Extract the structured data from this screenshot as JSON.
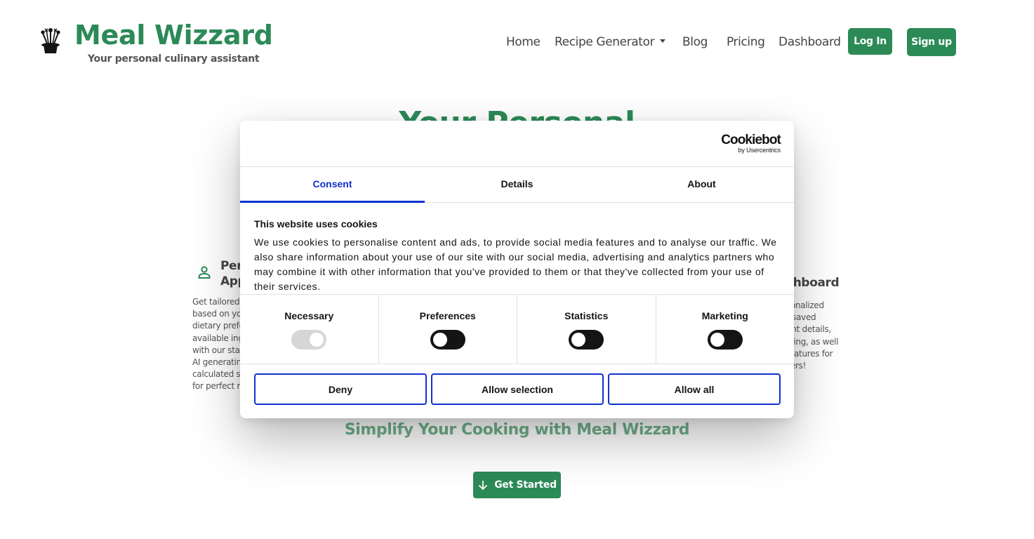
{
  "header": {
    "brand_title": "Meal Wizzard",
    "brand_subtitle": "Your personal culinary assistant",
    "logo_icon": "magic-hat-icon",
    "nav": {
      "home": "Home",
      "recipe_generator": "Recipe Generator",
      "blog": "Blog",
      "pricing": "Pricing",
      "dashboard": "Dashboard"
    },
    "login_label": "Log In",
    "signup_label": "Sign up"
  },
  "hero": {
    "title": "Your Personal"
  },
  "features": {
    "left": {
      "icon": "person-icon",
      "title_lines": [
        "Pers",
        "App"
      ],
      "text_lines": [
        "Get tailored r",
        "based on you",
        "dietary prefe",
        "available ingr",
        "with our stat",
        "AI generating",
        "calculated se",
        "for perfect m"
      ]
    },
    "right": {
      "title_lines": [
        "r",
        "shboard"
      ],
      "text_lines": [
        "sonalized",
        "r saved",
        "unt details,",
        "sting, as well",
        "features for",
        "sers!"
      ]
    }
  },
  "cta": {
    "simplify_text": "Simplify Your Cooking with Meal Wizzard",
    "get_started_label": "Get Started",
    "get_started_icon": "arrow-down-icon"
  },
  "cookie_dialog": {
    "logo_text": "Cookiebot",
    "logo_sub": "by Usercentrics",
    "tabs": {
      "consent": "Consent",
      "details": "Details",
      "about": "About"
    },
    "active_tab": "Consent",
    "heading": "This website uses cookies",
    "body": "We use cookies to personalise content and ads, to provide social media features and to analyse our traffic. We also share information about your use of our site with our social media, advertising and analytics partners who may combine it with other information that you've provided to them or that they've collected from your use of their services.",
    "toggles": {
      "necessary": {
        "label": "Necessary",
        "checked": true,
        "disabled": true
      },
      "preferences": {
        "label": "Preferences",
        "checked": false
      },
      "statistics": {
        "label": "Statistics",
        "checked": false
      },
      "marketing": {
        "label": "Marketing",
        "checked": false
      }
    },
    "buttons": {
      "deny": "Deny",
      "allow_selection": "Allow selection",
      "allow_all": "Allow all"
    }
  },
  "colors": {
    "brand_green": "#2c8a57",
    "light_green": "#6fb08a",
    "cookiebot_blue": "#1032cf"
  }
}
